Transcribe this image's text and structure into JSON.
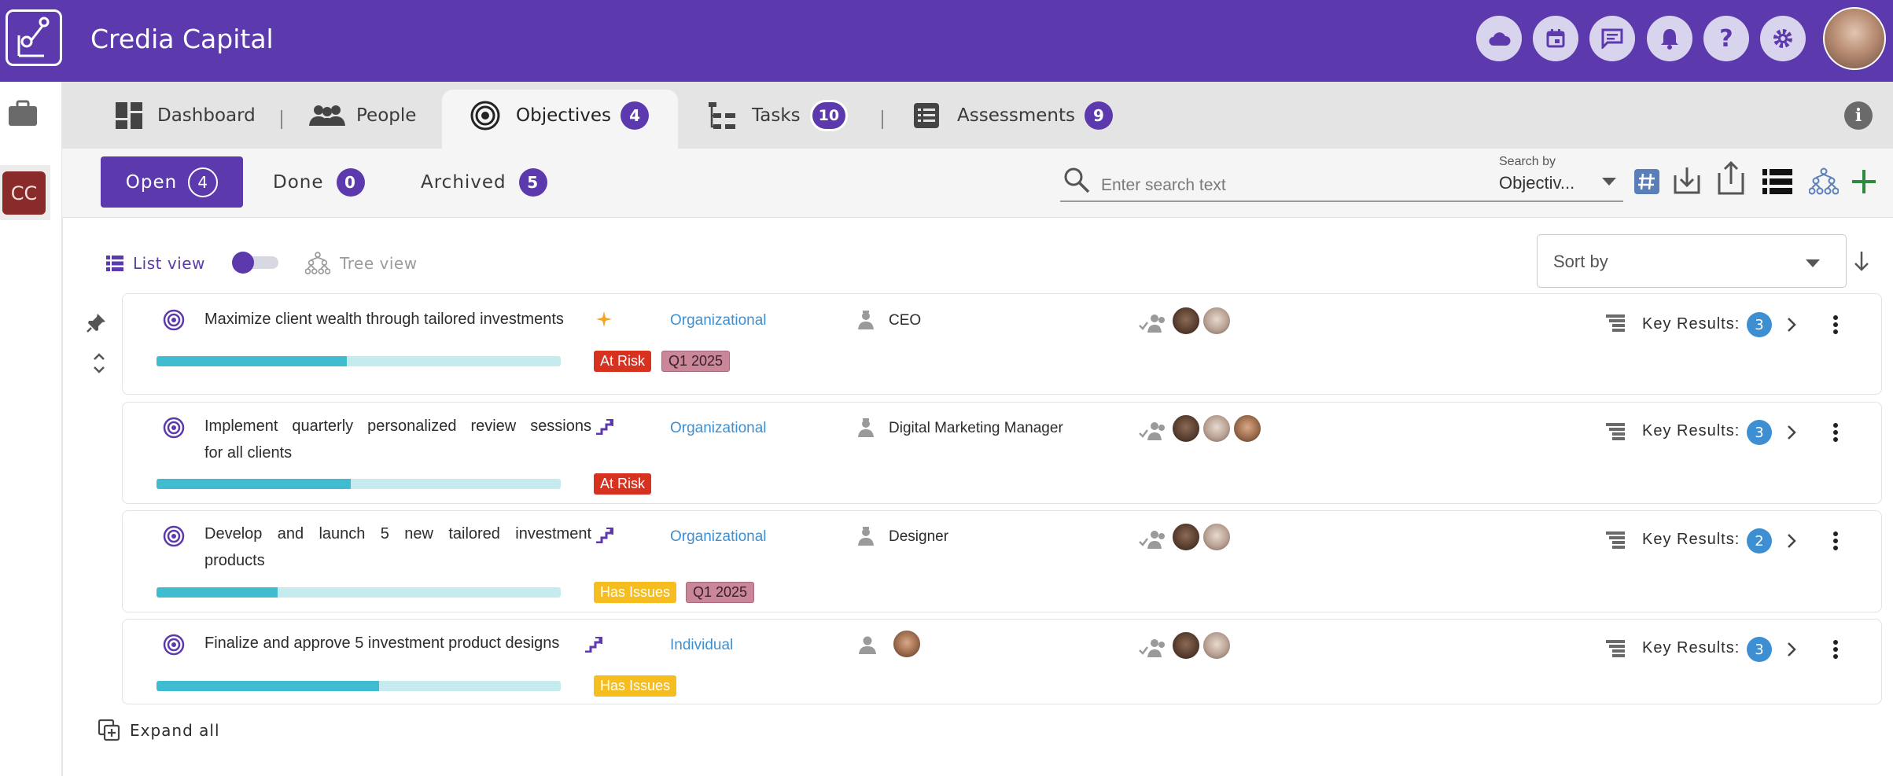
{
  "app": {
    "title": "Credia Capital"
  },
  "rail": {
    "company_initials": "CC"
  },
  "tabs": [
    {
      "label": "Dashboard"
    },
    {
      "label": "People"
    },
    {
      "label": "Objectives",
      "count": "4"
    },
    {
      "label": "Tasks",
      "count": "10"
    },
    {
      "label": "Assessments",
      "count": "9"
    }
  ],
  "filters": {
    "open": {
      "label": "Open",
      "count": "4"
    },
    "done": {
      "label": "Done",
      "count": "0"
    },
    "archived": {
      "label": "Archived",
      "count": "5"
    }
  },
  "search": {
    "placeholder": "Enter search text",
    "search_by_label": "Search by",
    "search_by_value": "Objectiv..."
  },
  "view": {
    "list_label": "List view",
    "tree_label": "Tree view",
    "sort_placeholder": "Sort by"
  },
  "objectives": [
    {
      "title_line1": "Maximize client wealth through tailored investments",
      "title_line2": "",
      "scope": "Organizational",
      "owner": "CEO",
      "progress": 0.47,
      "tags": [
        "At Risk",
        "Q1 2025"
      ],
      "key_results_label": "Key Results:",
      "key_results_count": "3"
    },
    {
      "title_line1": "Implement quarterly personalized review sessions",
      "title_line2": "for all clients",
      "scope": "Organizational",
      "owner": "Digital Marketing Manager",
      "progress": 0.48,
      "tags": [
        "At Risk"
      ],
      "key_results_label": "Key Results:",
      "key_results_count": "3"
    },
    {
      "title_line1": "Develop and launch 5 new tailored investment",
      "title_line2": "products",
      "scope": "Organizational",
      "owner": "Designer",
      "progress": 0.3,
      "tags": [
        "Has Issues",
        "Q1 2025"
      ],
      "key_results_label": "Key Results:",
      "key_results_count": "2"
    },
    {
      "title_line1": "Finalize and approve 5 investment product designs",
      "title_line2": "",
      "scope": "Individual",
      "owner": "",
      "progress": 0.55,
      "tags": [
        "Has Issues"
      ],
      "key_results_label": "Key Results:",
      "key_results_count": "3"
    }
  ],
  "footer": {
    "expand_all": "Expand all"
  },
  "colors": {
    "brand": "#5c3aad",
    "at_risk": "#d6321f",
    "has_issues": "#f5bd1f",
    "quarter": "#c98799",
    "progress": "#3fbcd0",
    "link": "#3f8fcf"
  }
}
